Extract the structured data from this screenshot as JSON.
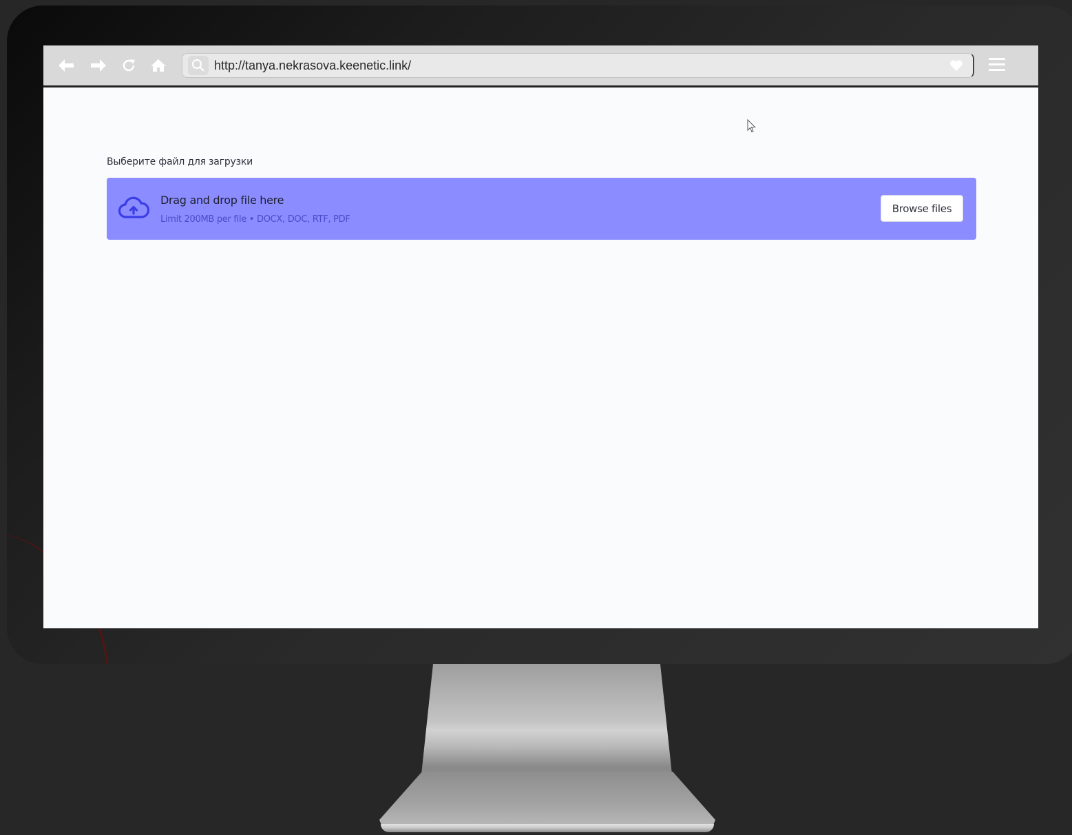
{
  "browser": {
    "url": "http://tanya.nekrasova.keenetic.link/",
    "icons": {
      "back": "arrow-left-icon",
      "forward": "arrow-right-icon",
      "reload": "reload-icon",
      "home": "home-icon",
      "search": "search-icon",
      "favorite": "heart-icon",
      "menu": "hamburger-menu-icon"
    }
  },
  "page": {
    "upload_label": "Выберите файл для загрузки",
    "dropzone": {
      "title": "Drag and drop file here",
      "limit": "Limit 200MB per file • DOCX, DOC, RTF, PDF",
      "button_label": "Browse files",
      "icon": "cloud-upload-icon"
    }
  },
  "colors": {
    "dropzone_bg": "#8a8cff",
    "accent": "#4b4dc8",
    "toolbar_bg": "#d9d9d9",
    "screen_bg": "#fafbfd"
  }
}
